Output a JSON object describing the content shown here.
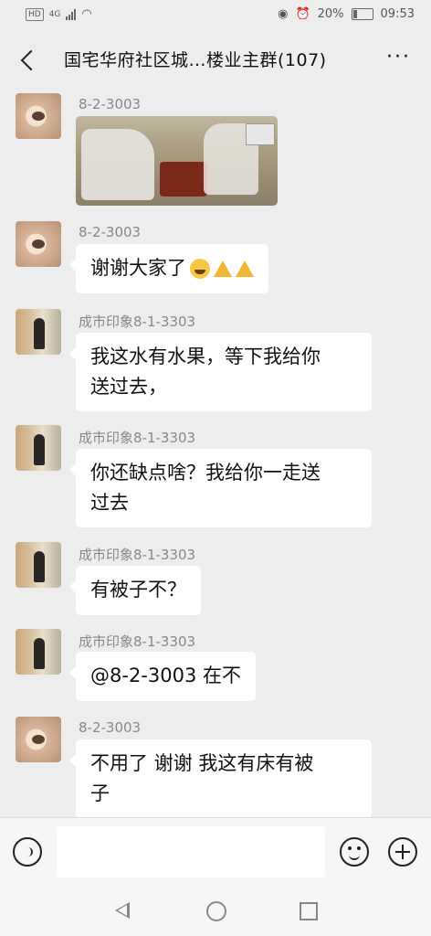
{
  "status_bar": {
    "network": "4G",
    "battery": "20%",
    "time": "09:53"
  },
  "header": {
    "title": "国宅华府社区城…楼业主群(107)",
    "more": "···"
  },
  "messages": [
    {
      "sender": "8-2-3003",
      "type": "image"
    },
    {
      "sender": "8-2-3003",
      "type": "text",
      "text": "谢谢大家了"
    },
    {
      "sender": "成市印象8-1-3303",
      "type": "text",
      "line1": "我这水有水果，等下我给你",
      "line2": "送过去，"
    },
    {
      "sender": "成市印象8-1-3303",
      "type": "text",
      "line1": "你还缺点啥？我给你一走送",
      "line2": "过去"
    },
    {
      "sender": "成市印象8-1-3303",
      "type": "text",
      "text": "有被子不？"
    },
    {
      "sender": "成市印象8-1-3303",
      "type": "text",
      "text": "@8-2-3003 在不"
    },
    {
      "sender": "8-2-3003",
      "type": "text",
      "line1": "不用了 谢谢 我这有床有被",
      "line2": "子"
    }
  ],
  "icons": [
    "back-icon",
    "more-icon",
    "voice-icon",
    "emoji-icon",
    "plus-icon",
    "nav-back-icon",
    "nav-home-icon",
    "nav-recent-icon"
  ]
}
